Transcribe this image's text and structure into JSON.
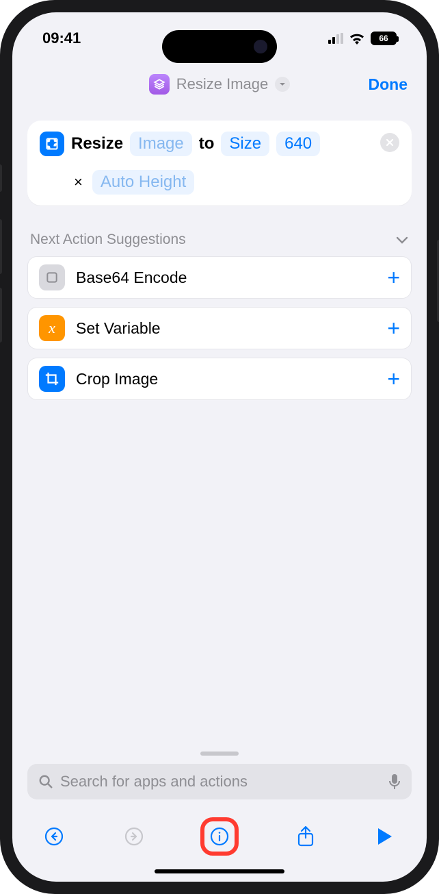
{
  "status": {
    "time": "09:41",
    "battery": "66"
  },
  "header": {
    "title": "Resize Image",
    "done": "Done"
  },
  "action": {
    "verb": "Resize",
    "input": "Image",
    "to": "to",
    "sizeLabel": "Size",
    "sizeValue": "640",
    "mult": "×",
    "height": "Auto Height"
  },
  "suggestionsHeader": "Next Action Suggestions",
  "suggestions": [
    {
      "label": "Base64 Encode",
      "iconBg": "#d9d9de",
      "iconName": "square-icon"
    },
    {
      "label": "Set Variable",
      "iconBg": "#ff9500",
      "iconName": "variable-icon"
    },
    {
      "label": "Crop Image",
      "iconBg": "#007aff",
      "iconName": "crop-icon"
    }
  ],
  "search": {
    "placeholder": "Search for apps and actions"
  }
}
